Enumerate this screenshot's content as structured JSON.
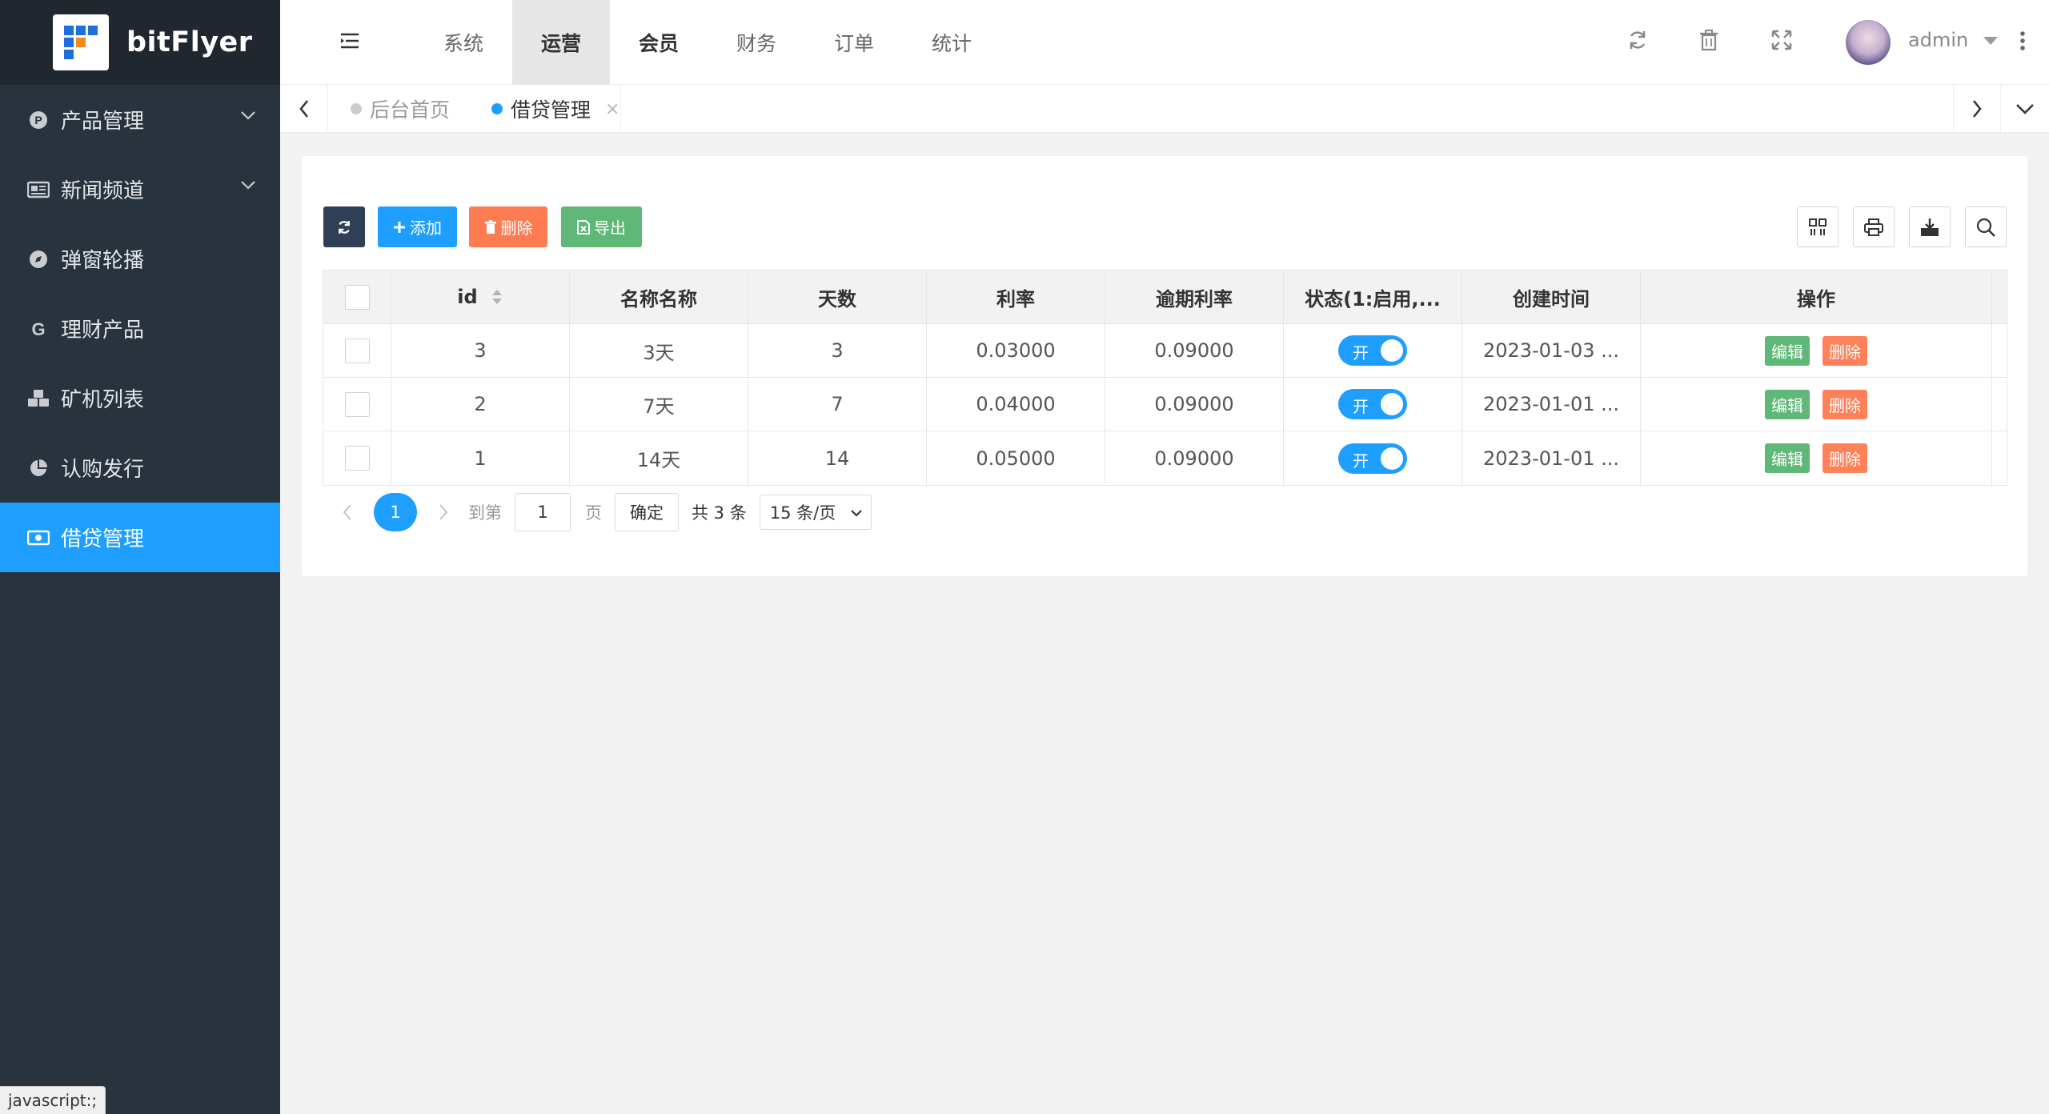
{
  "app": {
    "name": "bitFlyer"
  },
  "sidebar": {
    "items": [
      {
        "label": "产品管理",
        "icon": "product-icon",
        "expandable": true,
        "active": false
      },
      {
        "label": "新闻频道",
        "icon": "newspaper-icon",
        "expandable": true,
        "active": false
      },
      {
        "label": "弹窗轮播",
        "icon": "compass-icon",
        "expandable": false,
        "active": false
      },
      {
        "label": "理财产品",
        "icon": "google-icon",
        "expandable": false,
        "active": false
      },
      {
        "label": "矿机列表",
        "icon": "cubes-icon",
        "expandable": false,
        "active": false
      },
      {
        "label": "认购发行",
        "icon": "pie-chart-icon",
        "expandable": false,
        "active": false
      },
      {
        "label": "借贷管理",
        "icon": "money-icon",
        "expandable": false,
        "active": true
      }
    ]
  },
  "header": {
    "nav": [
      "系统",
      "运营",
      "会员",
      "财务",
      "订单",
      "统计"
    ],
    "active_nav": "运营",
    "username": "admin"
  },
  "tabs": [
    {
      "label": "后台首页",
      "active": false
    },
    {
      "label": "借贷管理",
      "active": true
    }
  ],
  "toolbar": {
    "add": "添加",
    "delete": "删除",
    "export": "导出"
  },
  "table": {
    "columns": [
      "id",
      "名称名称",
      "天数",
      "利率",
      "逾期利率",
      "状态(1:启用,...",
      "创建时间",
      "操作"
    ],
    "rows": [
      {
        "id": "3",
        "name": "3天",
        "days": "3",
        "rate": "0.03000",
        "overdue_rate": "0.09000",
        "status": "开",
        "created": "2023-01-03 ...",
        "edit": "编辑",
        "del": "删除"
      },
      {
        "id": "2",
        "name": "7天",
        "days": "7",
        "rate": "0.04000",
        "overdue_rate": "0.09000",
        "status": "开",
        "created": "2023-01-01 ...",
        "edit": "编辑",
        "del": "删除"
      },
      {
        "id": "1",
        "name": "14天",
        "days": "14",
        "rate": "0.05000",
        "overdue_rate": "0.09000",
        "status": "开",
        "created": "2023-01-01 ...",
        "edit": "编辑",
        "del": "删除"
      }
    ]
  },
  "pagination": {
    "current_page": "1",
    "goto_label": "到第",
    "goto_value": "1",
    "page_label": "页",
    "confirm": "确定",
    "total": "共 3 条",
    "page_size": "15 条/页"
  },
  "statusbar": {
    "text": "javascript:;"
  },
  "colors": {
    "sidebar_bg": "#28333e",
    "logo_bg": "#20272f",
    "accent": "#1e9fff",
    "btn_dark": "#2f4056",
    "btn_red": "#ff5722",
    "btn_green": "#5fb878",
    "tag_green": "#009688"
  }
}
